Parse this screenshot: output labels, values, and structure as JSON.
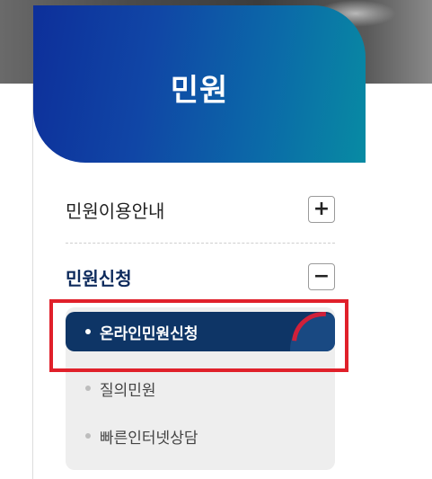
{
  "header": {
    "title": "민원"
  },
  "menu": [
    {
      "label": "민원이용안내",
      "toggle": "+"
    },
    {
      "label": "민원신청",
      "toggle": "−"
    }
  ],
  "submenu": [
    {
      "label": "온라인민원신청",
      "active": true
    },
    {
      "label": "질의민원",
      "active": false
    },
    {
      "label": "빠른인터넷상담",
      "active": false
    }
  ],
  "colors": {
    "header_gradient_start": "#0d2f9a",
    "header_gradient_end": "#088ba3",
    "active_item_bg": "#0e3566",
    "active_label": "#0d2a5c",
    "highlight": "#e0202a"
  }
}
